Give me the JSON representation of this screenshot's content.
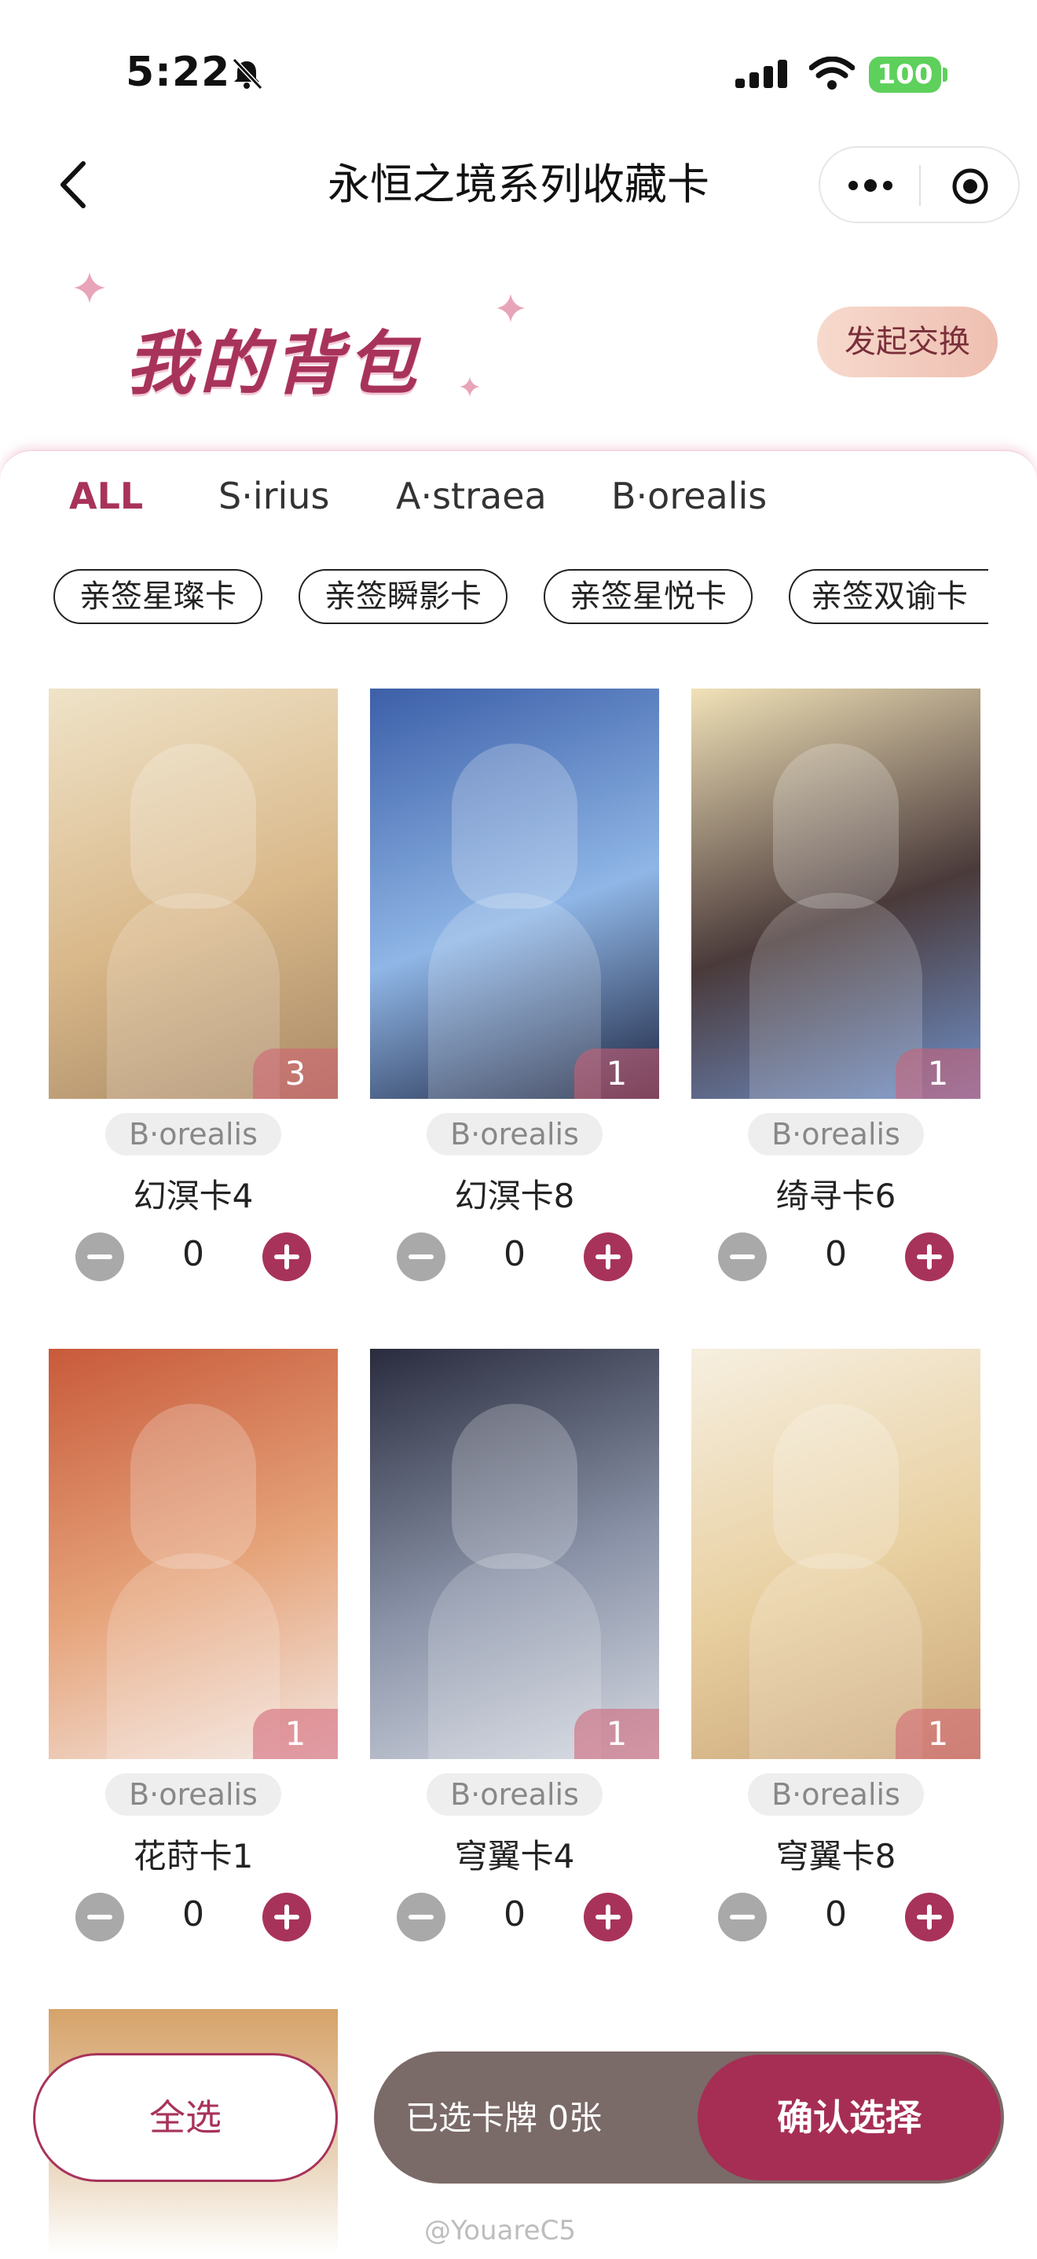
{
  "status_bar": {
    "time": "5:22",
    "battery": "100"
  },
  "nav": {
    "title": "永恒之境系列收藏卡"
  },
  "header": {
    "bag_title": "我的背包",
    "exchange_button": "发起交换"
  },
  "tabs": [
    "ALL",
    "S·irius",
    "A·straea",
    "B·orealis"
  ],
  "chips": [
    "亲签星璨卡",
    "亲签瞬影卡",
    "亲签星悦卡",
    "亲签双谕卡"
  ],
  "cards": [
    {
      "name": "幻溟卡4",
      "series": "B·orealis",
      "qty": "3",
      "count": "0",
      "colors": [
        "#efe3c8",
        "#d9b88a",
        "#a98a66"
      ]
    },
    {
      "name": "幻溟卡8",
      "series": "B·orealis",
      "qty": "1",
      "count": "0",
      "colors": [
        "#3c5fa8",
        "#8fb6e6",
        "#1c2440"
      ]
    },
    {
      "name": "绮寻卡6",
      "series": "B·orealis",
      "qty": "1",
      "count": "0",
      "colors": [
        "#f1e2b8",
        "#4a3a3a",
        "#6f8fc8"
      ]
    },
    {
      "name": "花莳卡1",
      "series": "B·orealis",
      "qty": "1",
      "count": "0",
      "colors": [
        "#c85a3a",
        "#e6a57c",
        "#f3e6e0"
      ]
    },
    {
      "name": "穹翼卡4",
      "series": "B·orealis",
      "qty": "1",
      "count": "0",
      "colors": [
        "#2a2c3e",
        "#8a93a8",
        "#d4d8e0"
      ]
    },
    {
      "name": "穹翼卡8",
      "series": "B·orealis",
      "qty": "1",
      "count": "0",
      "colors": [
        "#f6efe0",
        "#e8cfa0",
        "#caa77a"
      ]
    }
  ],
  "partial_card": {
    "colors": [
      "#d6a36a",
      "#e8d3b8"
    ]
  },
  "bottom_bar": {
    "select_all": "全选",
    "selected_count": "已选卡牌 0张",
    "confirm": "确认选择"
  },
  "watermark": "@YouareC5",
  "accent_color": "#a8335a"
}
